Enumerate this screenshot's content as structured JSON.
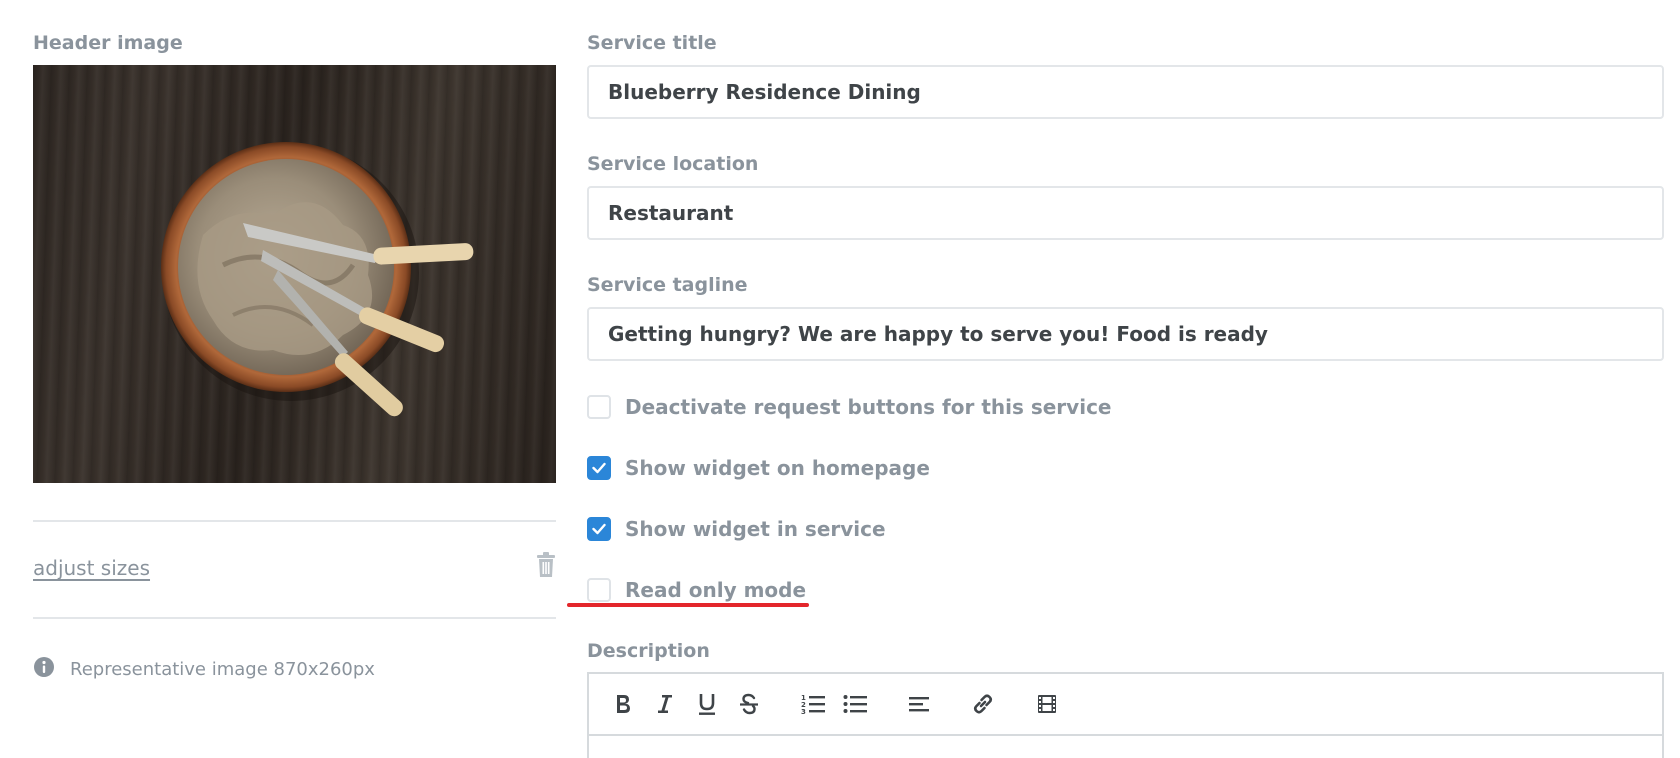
{
  "left": {
    "header_image_label": "Header image",
    "adjust_sizes_link": "adjust sizes",
    "info_text": "Representative image 870x260px"
  },
  "form": {
    "title_label": "Service title",
    "title_value": "Blueberry Residence Dining",
    "location_label": "Service location",
    "location_value": "Restaurant",
    "tagline_label": "Service tagline",
    "tagline_value": "Getting hungry? We are happy to serve you! Food is ready",
    "checkboxes": [
      {
        "label": "Deactivate request buttons for this service",
        "checked": false
      },
      {
        "label": "Show widget on homepage",
        "checked": true
      },
      {
        "label": "Show widget in service",
        "checked": true
      },
      {
        "label": "Read only mode",
        "checked": false
      }
    ],
    "description_label": "Description"
  },
  "toolbar": {
    "buttons": [
      "bold-icon",
      "italic-icon",
      "underline-icon",
      "strikethrough-icon",
      "ordered-list-icon",
      "bullet-list-icon",
      "align-left-icon",
      "link-icon",
      "video-icon"
    ]
  },
  "colors": {
    "accent": "#2b86d8",
    "label": "#8a939c",
    "border": "#e3e6e9",
    "highlight": "#e3262b"
  }
}
